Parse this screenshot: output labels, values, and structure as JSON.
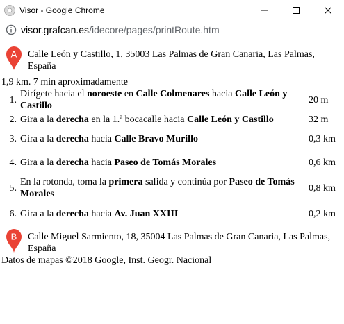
{
  "window": {
    "title": "Visor - Google Chrome"
  },
  "address": {
    "host": "visor.grafcan.es",
    "path": "/idecore/pages/printRoute.htm"
  },
  "markers": {
    "a": "A",
    "b": "B",
    "color": "#ea4335"
  },
  "route": {
    "start": "Calle León y Castillo, 1, 35003 Las Palmas de Gran Canaria, Las Palmas, España",
    "summary": "1,9 km. 7 min aproximadamente",
    "end": "Calle Miguel Sarmiento, 18, 35004 Las Palmas de Gran Canaria, Las Palmas, España",
    "credit": "Datos de mapas ©2018 Google, Inst. Geogr. Nacional",
    "steps": [
      {
        "num": "1.",
        "distance": "20 m",
        "parts": [
          "Dirígete hacia el ",
          "noroeste",
          " en ",
          "Calle Colmenares",
          " hacia ",
          "Calle León y Castillo"
        ]
      },
      {
        "num": "2.",
        "distance": "32 m",
        "parts": [
          "Gira a la ",
          "derecha",
          " en la 1.ª bocacalle hacia ",
          "Calle León y Castillo"
        ]
      },
      {
        "num": "3.",
        "distance": "0,3 km",
        "parts": [
          "Gira a la ",
          "derecha",
          " hacia ",
          "Calle Bravo Murillo"
        ]
      },
      {
        "num": "4.",
        "distance": "0,6 km",
        "parts": [
          "Gira a la ",
          "derecha",
          " hacia ",
          "Paseo de Tomás Morales"
        ]
      },
      {
        "num": "5.",
        "distance": "0,8 km",
        "parts": [
          "En la rotonda, toma la ",
          "primera",
          " salida y continúa por ",
          "Paseo de Tomás Morales"
        ]
      },
      {
        "num": "6.",
        "distance": "0,2 km",
        "parts": [
          "Gira a la ",
          "derecha",
          " hacia ",
          "Av. Juan XXIII"
        ]
      }
    ]
  }
}
